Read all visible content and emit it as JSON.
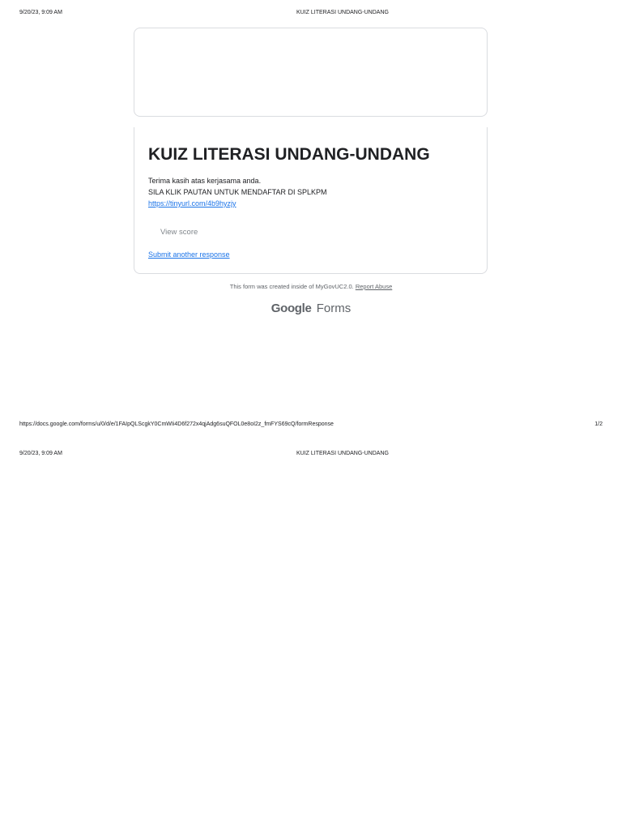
{
  "print_header_1": {
    "date": "9/20/23, 9:09 AM",
    "title": "KUIZ LITERASI UNDANG-UNDANG"
  },
  "form": {
    "title": "KUIZ LITERASI UNDANG-UNDANG",
    "message_line1": "Terima kasih atas kerjasama anda.",
    "message_line2": "SILA KLIK PAUTAN UNTUK MENDAFTAR DI SPLKPM",
    "link": "https://tinyurl.com/4b9hyzjy",
    "view_score_label": "View score",
    "submit_another_label": "Submit another response"
  },
  "footnote": {
    "text": "This form was created inside of MyGovUC2.0.",
    "report_label": "Report Abuse"
  },
  "logo": {
    "google": "Google",
    "forms": "Forms"
  },
  "print_footer": {
    "url": "https://docs.google.com/forms/u/0/d/e/1FAIpQLScgkY0CmWIi4D6f272x4qjAdg6suQFOL0e8oI2z_fmFYS69cQ/formResponse",
    "page": "1/2"
  },
  "print_header_2": {
    "date": "9/20/23, 9:09 AM",
    "title": "KUIZ LITERASI UNDANG-UNDANG"
  }
}
